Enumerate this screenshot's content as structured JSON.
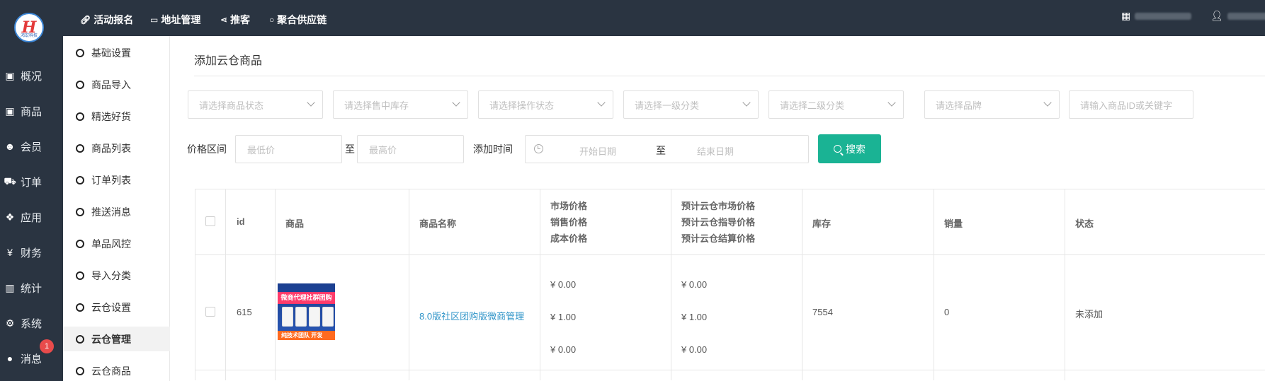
{
  "brand": {
    "mark": "H",
    "text": "鸿宏科技"
  },
  "topnav": [
    {
      "label": "活动报名",
      "icon": "link-icon"
    },
    {
      "label": "地址管理",
      "icon": "card-icon"
    },
    {
      "label": "推客",
      "icon": "share-icon"
    },
    {
      "label": "聚合供应链",
      "icon": "circle-icon"
    }
  ],
  "rail": [
    {
      "label": "概况",
      "icon": "archive-icon"
    },
    {
      "label": "商品",
      "icon": "archive-icon"
    },
    {
      "label": "会员",
      "icon": "users-icon"
    },
    {
      "label": "订单",
      "icon": "cart-icon"
    },
    {
      "label": "应用",
      "icon": "cubes-icon"
    },
    {
      "label": "财务",
      "icon": "yen-icon"
    },
    {
      "label": "统计",
      "icon": "bar-chart-icon"
    },
    {
      "label": "系统",
      "icon": "gears-icon"
    },
    {
      "label": "消息",
      "icon": "comment-icon"
    }
  ],
  "message_badge": "1",
  "subnav": [
    {
      "label": "基础设置",
      "active": false
    },
    {
      "label": "商品导入",
      "active": false
    },
    {
      "label": "精选好货",
      "active": false
    },
    {
      "label": "商品列表",
      "active": false
    },
    {
      "label": "订单列表",
      "active": false
    },
    {
      "label": "推送消息",
      "active": false
    },
    {
      "label": "单品风控",
      "active": false
    },
    {
      "label": "导入分类",
      "active": false
    },
    {
      "label": "云仓设置",
      "active": false
    },
    {
      "label": "云仓管理",
      "active": true
    },
    {
      "label": "云仓商品",
      "active": false
    }
  ],
  "page_title": "添加云仓商品",
  "filters": {
    "selects": [
      "请选择商品状态",
      "请选择售中库存",
      "请选择操作状态",
      "请选择一级分类",
      "请选择二级分类",
      "请选择品牌"
    ],
    "keyword_placeholder": "请输入商品ID或关键字",
    "price_label": "价格区间",
    "price_min_placeholder": "最低价",
    "price_sep": "至",
    "price_max_placeholder": "最高价",
    "time_label": "添加时间",
    "date_start_placeholder": "开始日期",
    "date_sep": "至",
    "date_end_placeholder": "结束日期",
    "search_label": "搜索"
  },
  "table": {
    "headers": {
      "id": "id",
      "image": "商品",
      "name": "商品名称",
      "price": [
        "市场价格",
        "销售价格",
        "成本价格"
      ],
      "cloud_price": [
        "预计云仓市场价格",
        "预计云仓指导价格",
        "预计云仓结算价格"
      ],
      "stock": "库存",
      "sales": "销量",
      "status": "状态"
    },
    "rows": [
      {
        "id": "615",
        "thumb_banner": "微商代理社群团购",
        "thumb_footer": "纯技术团队  开发",
        "name": "8.0版社区团购版微商管理",
        "prices": [
          "¥ 0.00",
          "¥ 1.00",
          "¥ 0.00"
        ],
        "cloud_prices": [
          "¥ 0.00",
          "¥ 1.00",
          "¥ 0.00"
        ],
        "stock": "7554",
        "sales": "0",
        "status": "未添加"
      }
    ]
  }
}
